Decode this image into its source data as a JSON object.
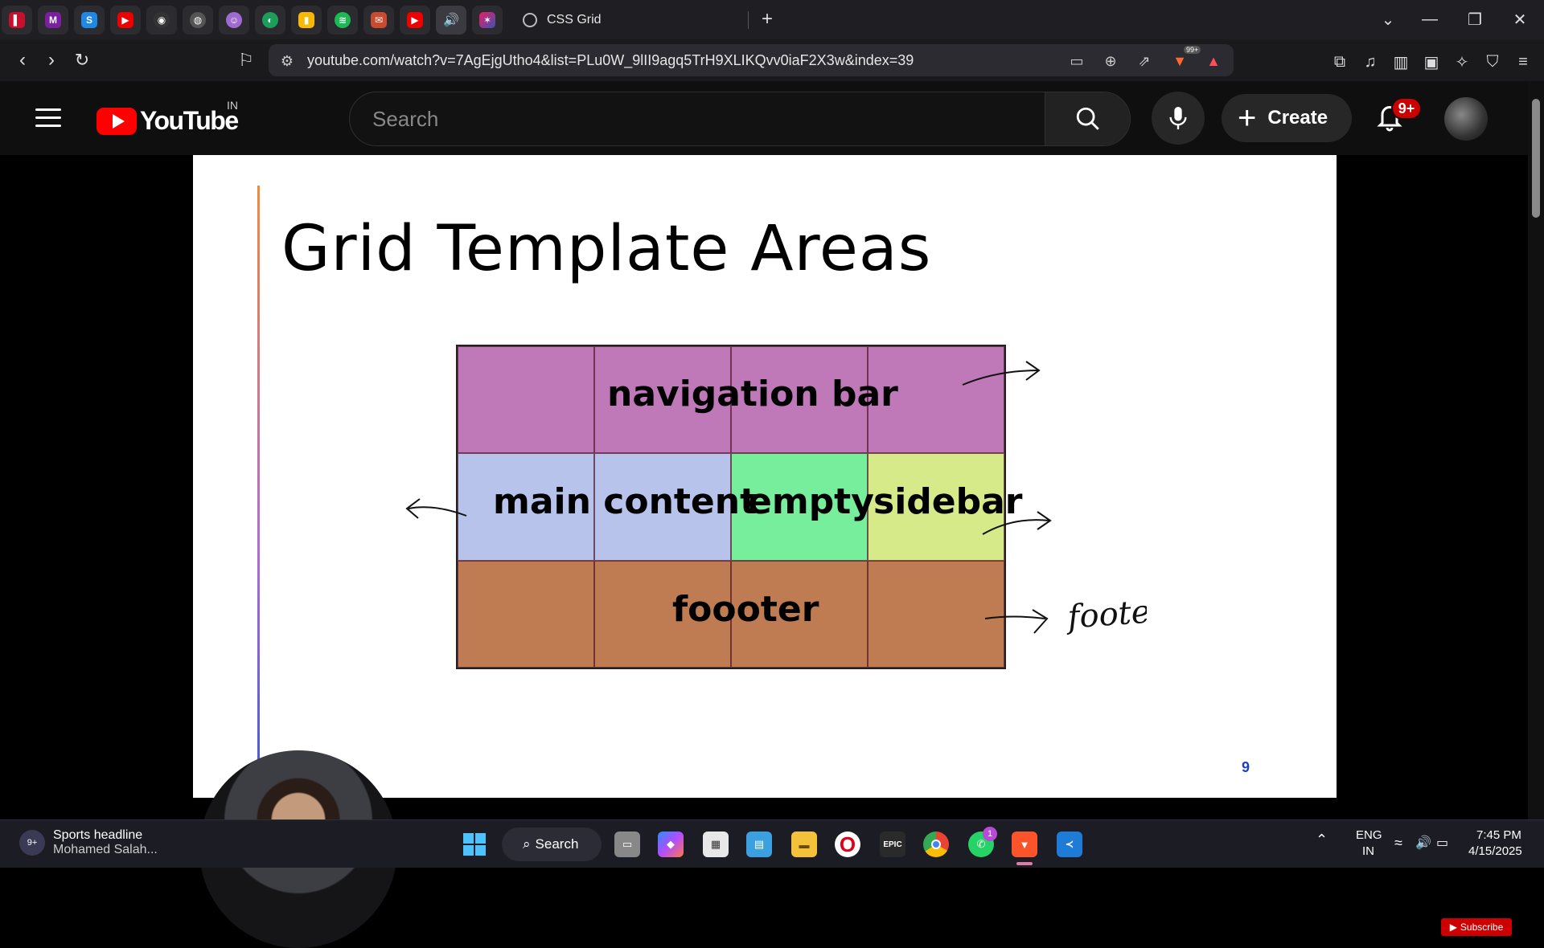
{
  "browser": {
    "active_tab_title": "CSS Grid",
    "new_tab": "+",
    "url": "youtube.com/watch?v=7AgEjgUtho4&list=PLu0W_9lII9agq5TrH9XLIKQvv0iaF2X3w&index=39",
    "brave_badge": "99+"
  },
  "youtube": {
    "logo_text": "YouTube",
    "country": "IN",
    "search_placeholder": "Search",
    "create_label": "Create",
    "notifications_badge": "9+"
  },
  "slide": {
    "title": "Grid Template Areas",
    "areas": {
      "nav": "navigation bar",
      "main": "main content",
      "empty": "empty",
      "sidebar": "sidebar",
      "footer": "foooter"
    },
    "area_colors": {
      "nav": "#bf79b8",
      "main": "#b7c3ea",
      "empty": "#77ee9b",
      "sidebar": "#d6ea8a",
      "footer": "#bf7c52"
    },
    "handwritten_note": "footer",
    "page_number": "9",
    "subscribe_label": "Subscribe"
  },
  "taskbar": {
    "news_badge": "9+",
    "news_title": "Sports headline",
    "news_subtitle": "Mohamed Salah...",
    "search_label": "Search",
    "whatsapp_badge": "1",
    "lang_line1": "ENG",
    "lang_line2": "IN",
    "time": "7:45 PM",
    "date": "4/15/2025"
  }
}
